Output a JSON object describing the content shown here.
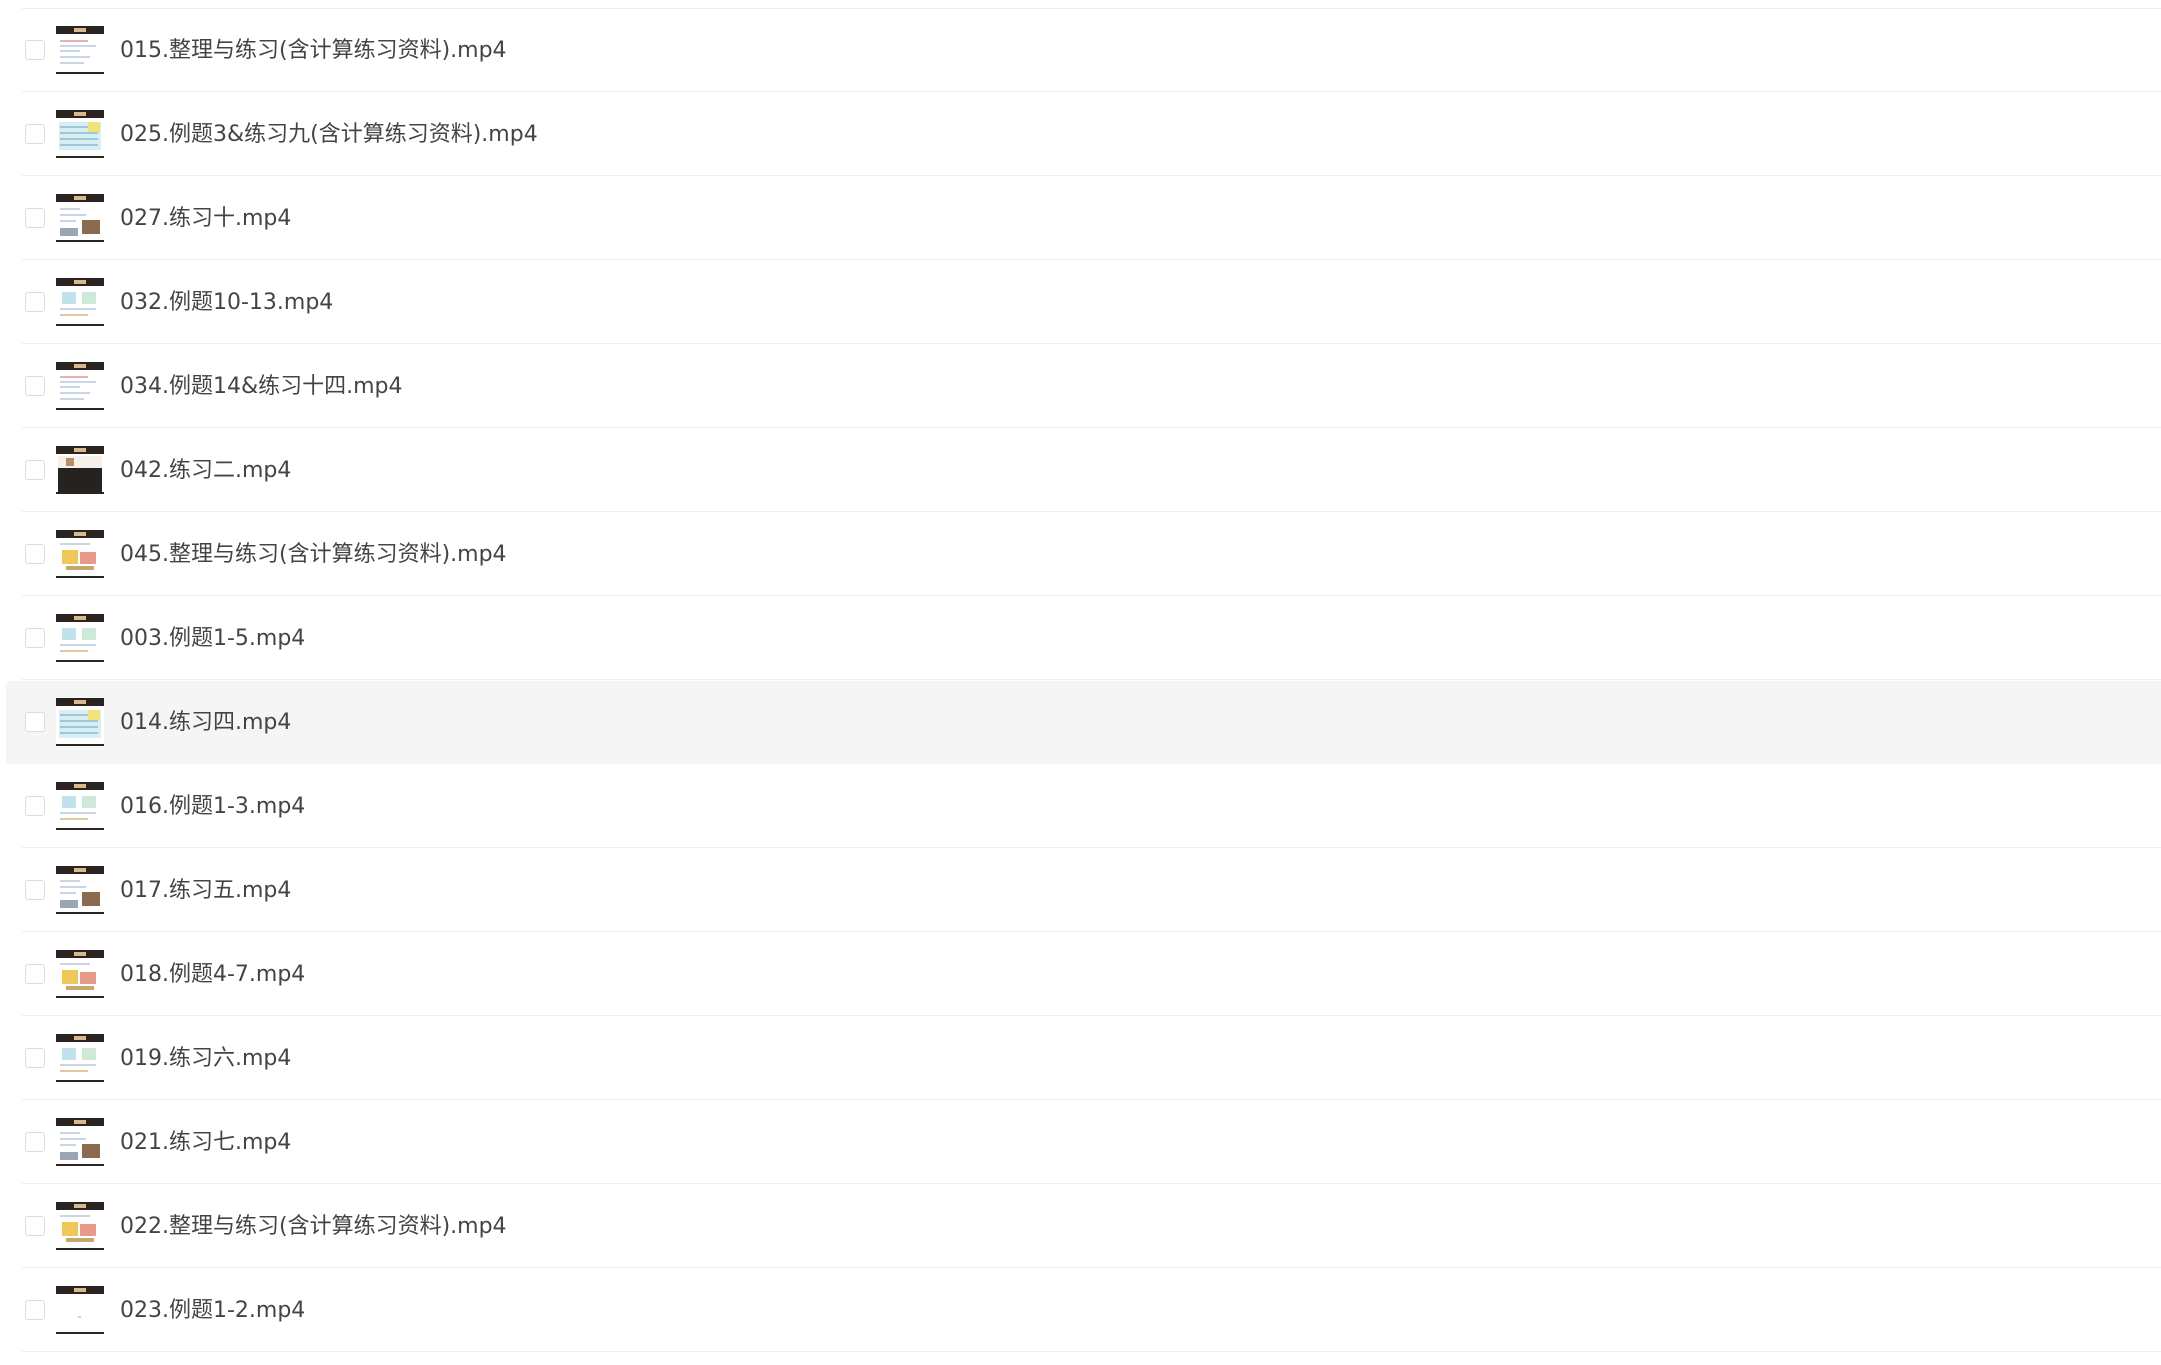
{
  "files": [
    {
      "name": "015.整理与练习(含计算练习资料).mp4",
      "thumb": "document-thumb"
    },
    {
      "name": "025.例题3&练习九(含计算练习资料).mp4",
      "thumb": "table-thumb"
    },
    {
      "name": "027.练习十.mp4",
      "thumb": "photo-thumb"
    },
    {
      "name": "032.例题10-13.mp4",
      "thumb": "diagram-thumb"
    },
    {
      "name": "034.例题14&练习十四.mp4",
      "thumb": "document-thumb"
    },
    {
      "name": "042.练习二.mp4",
      "thumb": "dark-thumb"
    },
    {
      "name": "045.整理与练习(含计算练习资料).mp4",
      "thumb": "illustration-thumb"
    },
    {
      "name": "003.例题1-5.mp4",
      "thumb": "diagram-thumb"
    },
    {
      "name": "014.练习四.mp4",
      "thumb": "table-thumb",
      "hovered": true
    },
    {
      "name": "016.例题1-3.mp4",
      "thumb": "diagram-thumb"
    },
    {
      "name": "017.练习五.mp4",
      "thumb": "photo-thumb"
    },
    {
      "name": "018.例题4-7.mp4",
      "thumb": "illustration-thumb"
    },
    {
      "name": "019.练习六.mp4",
      "thumb": "diagram-thumb"
    },
    {
      "name": "021.练习七.mp4",
      "thumb": "photo-thumb"
    },
    {
      "name": "022.整理与练习(含计算练习资料).mp4",
      "thumb": "illustration-thumb"
    },
    {
      "name": "023.例题1-2.mp4",
      "thumb": "blank-thumb"
    }
  ],
  "colors": {
    "text": "#444444",
    "divider": "#efefef",
    "hover_bg": "#f5f5f5",
    "checkbox_border": "#dcdcdc",
    "thumb_header": "#2a2320"
  }
}
